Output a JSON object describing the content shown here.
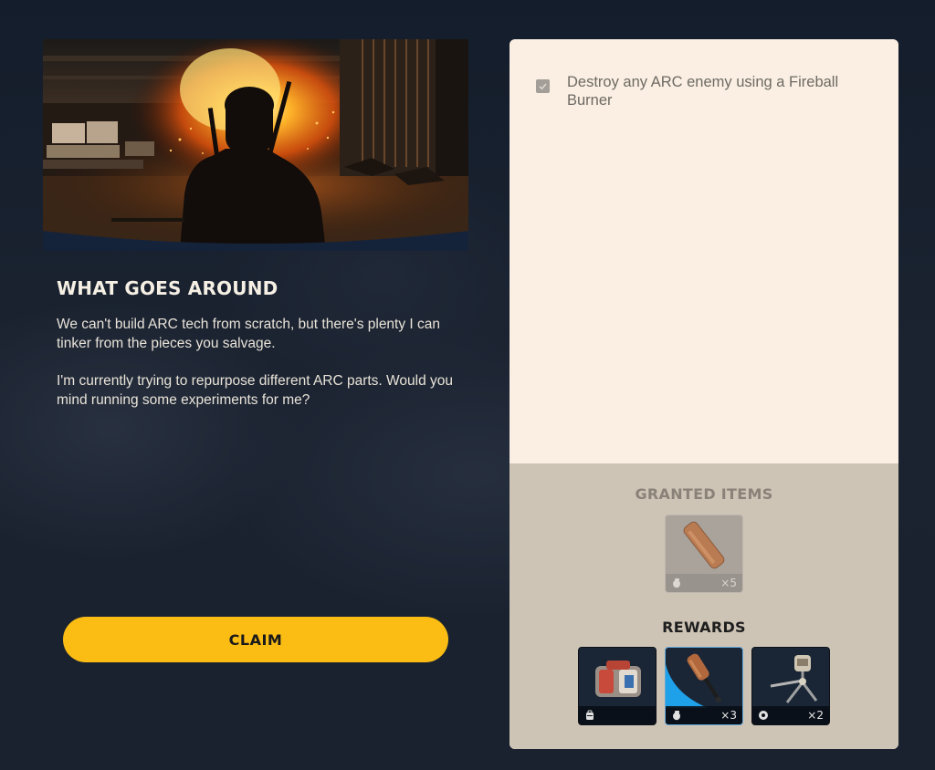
{
  "quest": {
    "title": "WHAT GOES AROUND",
    "description": [
      "We can't build ARC tech from scratch, but there's plenty I can tinker from the pieces you salvage.",
      "I'm currently trying to repurpose different ARC parts. Would you mind running some experiments for me?"
    ],
    "claim_label": "CLAIM"
  },
  "objectives": [
    {
      "text": "Destroy any ARC enemy using a Fireball Burner",
      "completed": true
    }
  ],
  "granted": {
    "label": "GRANTED ITEMS",
    "items": [
      {
        "name": "Fireball Burner",
        "quantity": "×5",
        "category_icon": "grenade-icon"
      }
    ]
  },
  "rewards": {
    "label": "REWARDS",
    "items": [
      {
        "name": "Augment",
        "quantity": "",
        "category_icon": "backpack-icon"
      },
      {
        "name": "Grenade",
        "quantity": "×3",
        "category_icon": "grenade-icon"
      },
      {
        "name": "Deployable",
        "quantity": "×2",
        "category_icon": "gadget-icon"
      }
    ]
  },
  "colors": {
    "accent": "#fbbd14",
    "panel": "#faefe2",
    "panel_footer": "#cec4b6",
    "rarity_blue": "#1fa1ea"
  }
}
